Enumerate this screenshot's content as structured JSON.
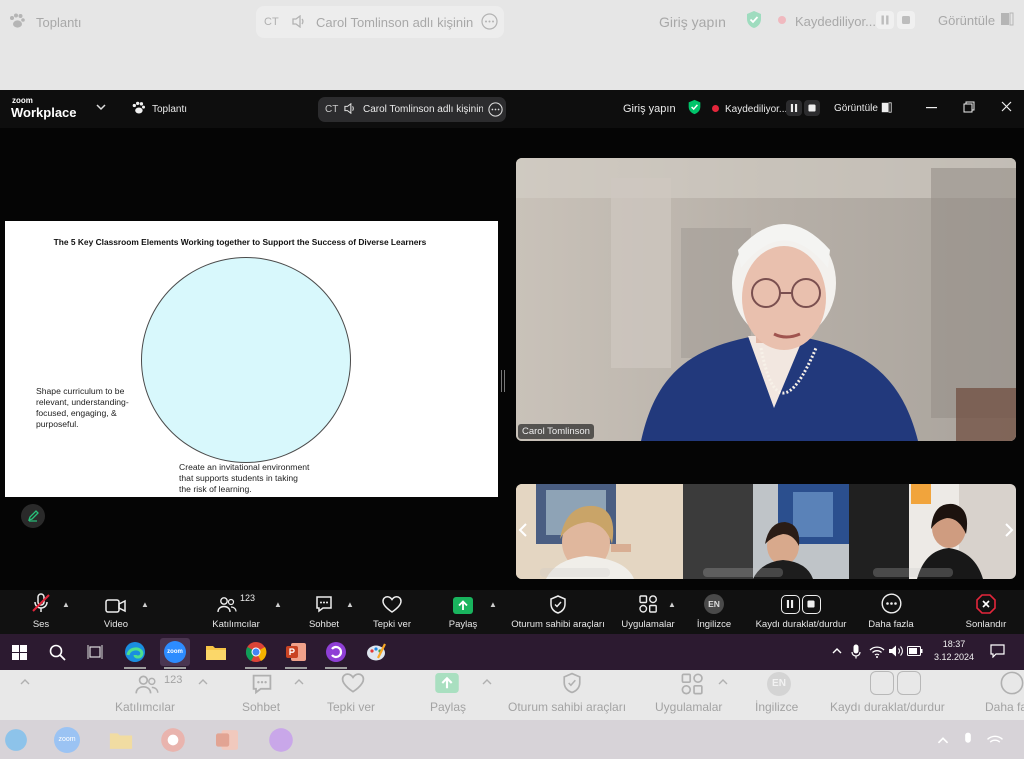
{
  "ghost_top": {
    "app_label": "Toplantı",
    "initials": "CT",
    "share_text": "Carol Tomlinson adlı kişinin ekranı",
    "signin": "Giriş yapın",
    "recording": "Kaydediliyor...",
    "view": "Görüntüle"
  },
  "titlebar": {
    "logo_top": "zoom",
    "logo_bottom": "Workplace",
    "meeting_label": "Toplantı",
    "initials": "CT",
    "share_text": "Carol Tomlinson adlı kişinin ekranı",
    "signin": "Giriş yapın",
    "recording": "Kaydediliyor...",
    "view": "Görüntüle"
  },
  "slide": {
    "title": "The 5 Key Classroom Elements Working together to Support the Success of Diverse Learners",
    "note_left": [
      "Shape curriculum to be",
      "relevant, understanding-",
      "focused, engaging, &",
      "purposeful."
    ],
    "note_bottom": [
      "Create an invitational environment",
      "that supports students in taking",
      "the risk of learning."
    ]
  },
  "speaker": {
    "name": "Carol Tomlinson"
  },
  "toolbar": {
    "audio": "Ses",
    "video": "Video",
    "participants": "Katılımcılar",
    "participant_count": "123",
    "chat": "Sohbet",
    "react": "Tepki ver",
    "share": "Paylaş",
    "host_tools": "Oturum sahibi araçları",
    "apps": "Uygulamalar",
    "language": "İngilizce",
    "language_code": "EN",
    "record": "Kaydı duraklat/durdur",
    "more": "Daha fazla",
    "end": "Sonlandır"
  },
  "taskbar": {
    "time": "18:37",
    "date": "3.12.2024",
    "zoom_badge": "zoom"
  },
  "ghost_bottom": {
    "participants": "Katılımcılar",
    "participant_count": "123",
    "chat": "Sohbet",
    "react": "Tepki ver",
    "share": "Paylaş",
    "host_tools": "Oturum sahibi araçları",
    "apps": "Uygulamalar",
    "language": "İngilizce",
    "language_code": "EN",
    "record": "Kaydı duraklat/durdur",
    "more": "Daha fazla",
    "zoom_badge": "zoom"
  },
  "colors": {
    "accent_green": "#00c46a",
    "end_red": "#e3263b",
    "share_green": "#19b45e",
    "taskbar": "#2c1a30"
  }
}
